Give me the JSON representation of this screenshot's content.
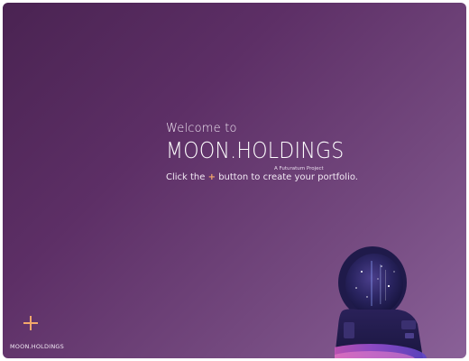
{
  "welcome": {
    "intro": "Welcome to",
    "title": "MOON.HOLDINGS",
    "subtitle": "A Futuratum Project",
    "cta_before": "Click the",
    "cta_plus": "+",
    "cta_after": "button to create your portfolio."
  },
  "footer": {
    "brand": "MOON.HOLDINGS"
  },
  "icons": {
    "add": "plus-icon",
    "illustration": "astronaut-icon"
  },
  "colors": {
    "accent": "#f3a86b",
    "background_start": "#4a2352",
    "background_end": "#8a6198"
  }
}
